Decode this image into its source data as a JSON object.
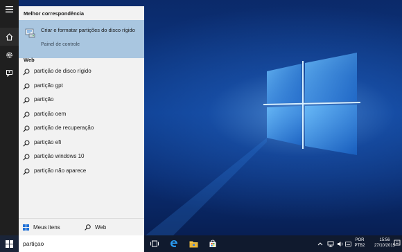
{
  "start_menu": {
    "best_match_header": "Melhor correspondência",
    "best_match": {
      "title": "Criar e formatar partições do disco rígido",
      "subtitle": "Painel de controle"
    },
    "web_header": "Web",
    "web_results": [
      "partição de disco rígido",
      "partição gpt",
      "partição",
      "partição oem",
      "partição de recuperação",
      "partição efi",
      "partição windows 10",
      "partição não aparece"
    ],
    "bottom": {
      "my_items_label": "Meus itens",
      "web_label": "Web"
    },
    "search": {
      "value": "partiçao"
    }
  },
  "rail": [
    "home-icon",
    "gear-icon",
    "feedback-icon"
  ],
  "taskbar": {
    "language": {
      "line1": "POR",
      "line2": "PTB2"
    },
    "clock": {
      "time": "15:56",
      "date": "27/10/2015"
    }
  },
  "colors": {
    "highlight": "#a9c6e0",
    "panel": "#f2f2f2",
    "rail": "#1f1f1f",
    "taskbar": "#101a2e"
  }
}
